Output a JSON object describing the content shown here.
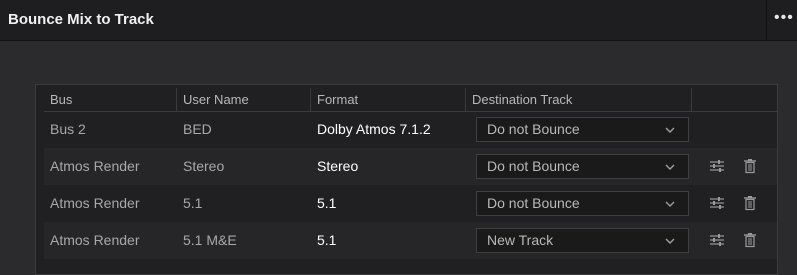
{
  "panel": {
    "title": "Bounce Mix to Track",
    "menu_glyph": "•••"
  },
  "table": {
    "columns": [
      "Bus",
      "User Name",
      "Format",
      "Destination Track"
    ],
    "rows": [
      {
        "bus": "Bus 2",
        "user_name": "BED",
        "format": "Dolby Atmos 7.1.2",
        "destination": "Do not Bounce",
        "has_actions": false
      },
      {
        "bus": "Atmos Render",
        "user_name": "Stereo",
        "format": "Stereo",
        "destination": "Do not Bounce",
        "has_actions": true
      },
      {
        "bus": "Atmos Render",
        "user_name": "5.1",
        "format": "5.1",
        "destination": "Do not Bounce",
        "has_actions": true
      },
      {
        "bus": "Atmos Render",
        "user_name": "5.1 M&E",
        "format": "5.1",
        "destination": "New Track",
        "has_actions": true
      }
    ]
  },
  "icons": {
    "settings": "sliders-icon",
    "delete": "trash-icon",
    "dropdown": "chevron-down-icon"
  },
  "colors": {
    "panel_bg": "#2b2b2d",
    "titlebar_bg": "#1e1e20",
    "table_bg": "#202022",
    "alt_row_bg": "#262628"
  }
}
